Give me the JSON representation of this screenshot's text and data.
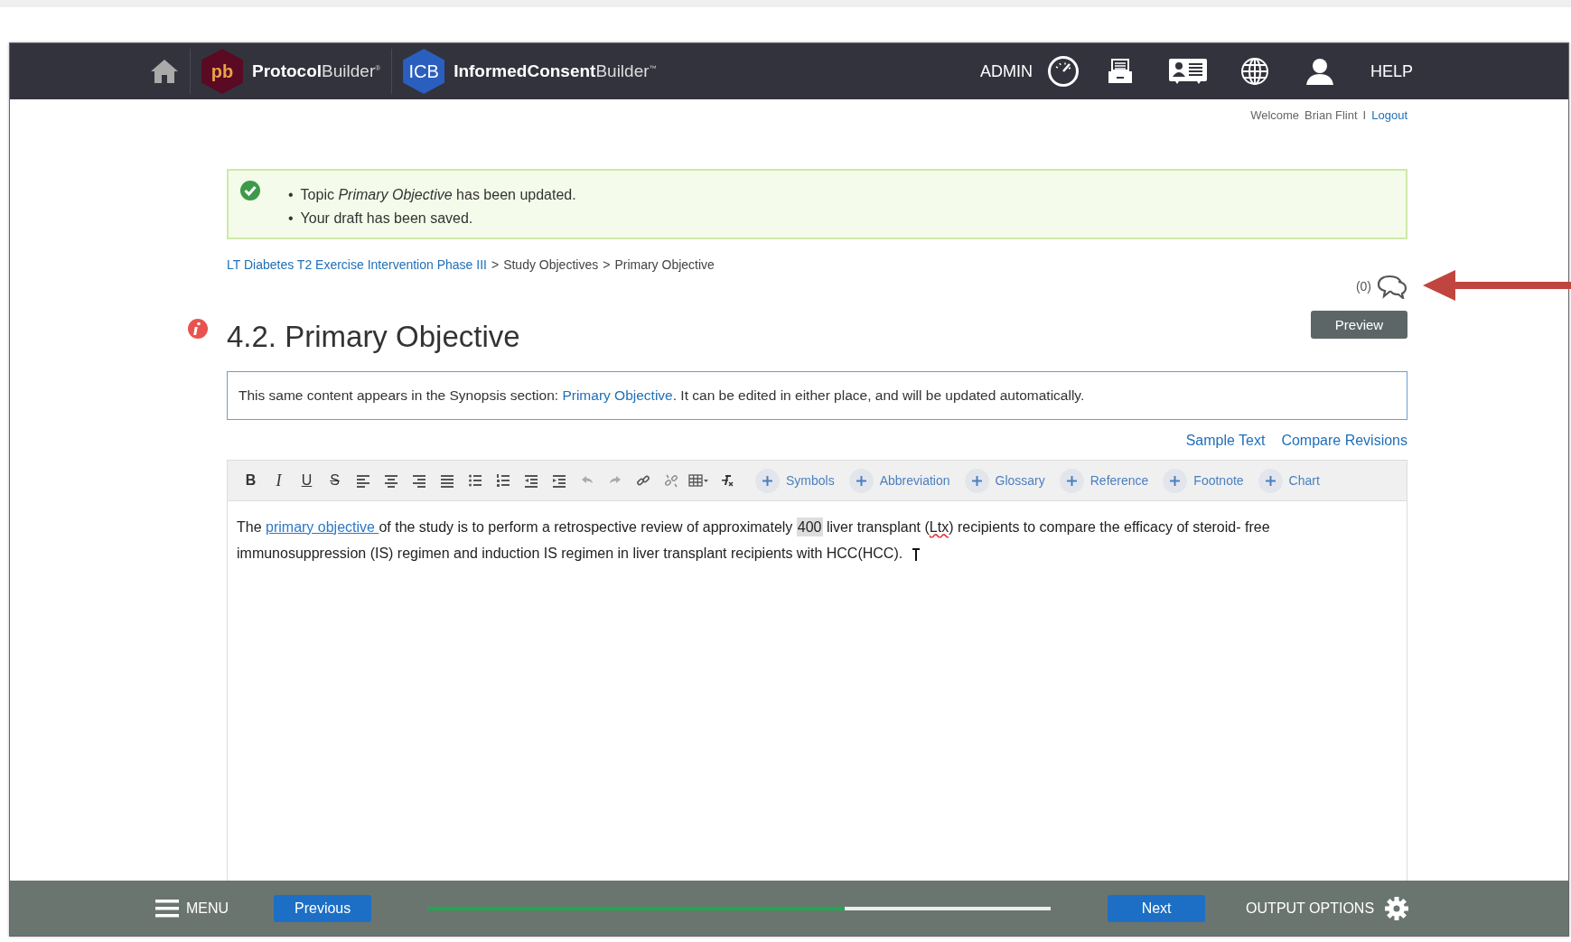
{
  "header": {
    "brands": [
      {
        "badge": "pb",
        "kind": "protocol",
        "name_bold": "Protocol",
        "name_light": "Builder",
        "mark": "®"
      },
      {
        "badge": "ICB",
        "kind": "consent",
        "name_bold": "InformedConsent",
        "name_light": "Builder",
        "mark": "™"
      }
    ],
    "admin": "ADMIN",
    "help": "HELP"
  },
  "user_bar": {
    "welcome": "Welcome",
    "user": "Brian Flint",
    "separator": "I",
    "logout": "Logout"
  },
  "alert": {
    "bullet": "•",
    "messages": [
      "Topic *Primary Objective* has been updated.",
      "Your draft has been saved."
    ]
  },
  "breadcrumb": {
    "separator": ">",
    "items": [
      {
        "label": "LT Diabetes T2 Exercise Intervention Phase III",
        "link": true
      },
      {
        "label": "Study Objectives",
        "link": false
      },
      {
        "label": "Primary Objective",
        "link": false
      }
    ]
  },
  "comments": {
    "count": "(0)"
  },
  "title": "4.2. Primary Objective",
  "preview": "Preview",
  "notice": {
    "before": "This same content appears in the Synopsis section: ",
    "link": "Primary Objective",
    "after": ". It can be edited in either place, and will be updated automatically."
  },
  "editor_links": [
    "Sample Text",
    "Compare Revisions"
  ],
  "toolbar": [
    {
      "kind": "bold",
      "label": "B"
    },
    {
      "kind": "italic",
      "label": "I"
    },
    {
      "kind": "underline",
      "label": "U"
    },
    {
      "kind": "strike",
      "label": "S"
    },
    {
      "kind": "align-left"
    },
    {
      "kind": "align-center"
    },
    {
      "kind": "align-right"
    },
    {
      "kind": "justify"
    },
    {
      "kind": "bullets"
    },
    {
      "kind": "numbers"
    },
    {
      "kind": "outdent"
    },
    {
      "kind": "indent"
    },
    {
      "kind": "undo"
    },
    {
      "kind": "redo"
    },
    {
      "kind": "link"
    },
    {
      "kind": "unlink"
    },
    {
      "kind": "table"
    },
    {
      "kind": "clear-format"
    }
  ],
  "inserts": [
    "Symbols",
    "Abbreviation",
    "Glossary",
    "Reference",
    "Footnote",
    "Chart"
  ],
  "editor": {
    "segments": [
      {
        "kind": "text",
        "text": "The "
      },
      {
        "kind": "link",
        "text": "primary objective "
      },
      {
        "kind": "text",
        "text": " of the study is to perform a retrospective review of approximately "
      },
      {
        "kind": "highlight",
        "text": "400"
      },
      {
        "kind": "text",
        "text": " liver transplant ("
      },
      {
        "kind": "misspelled",
        "text": "Ltx"
      },
      {
        "kind": "text",
        "text": ") recipients to compare the efficacy of steroid- free immunosuppression (IS) regimen and induction IS regimen in liver transplant recipients with HCC(HCC). "
      }
    ]
  },
  "footer": {
    "menu": "MENU",
    "previous": "Previous",
    "progress": {
      "level": 0.67
    },
    "next": "Next",
    "output_options": "OUTPUT OPTIONS"
  }
}
